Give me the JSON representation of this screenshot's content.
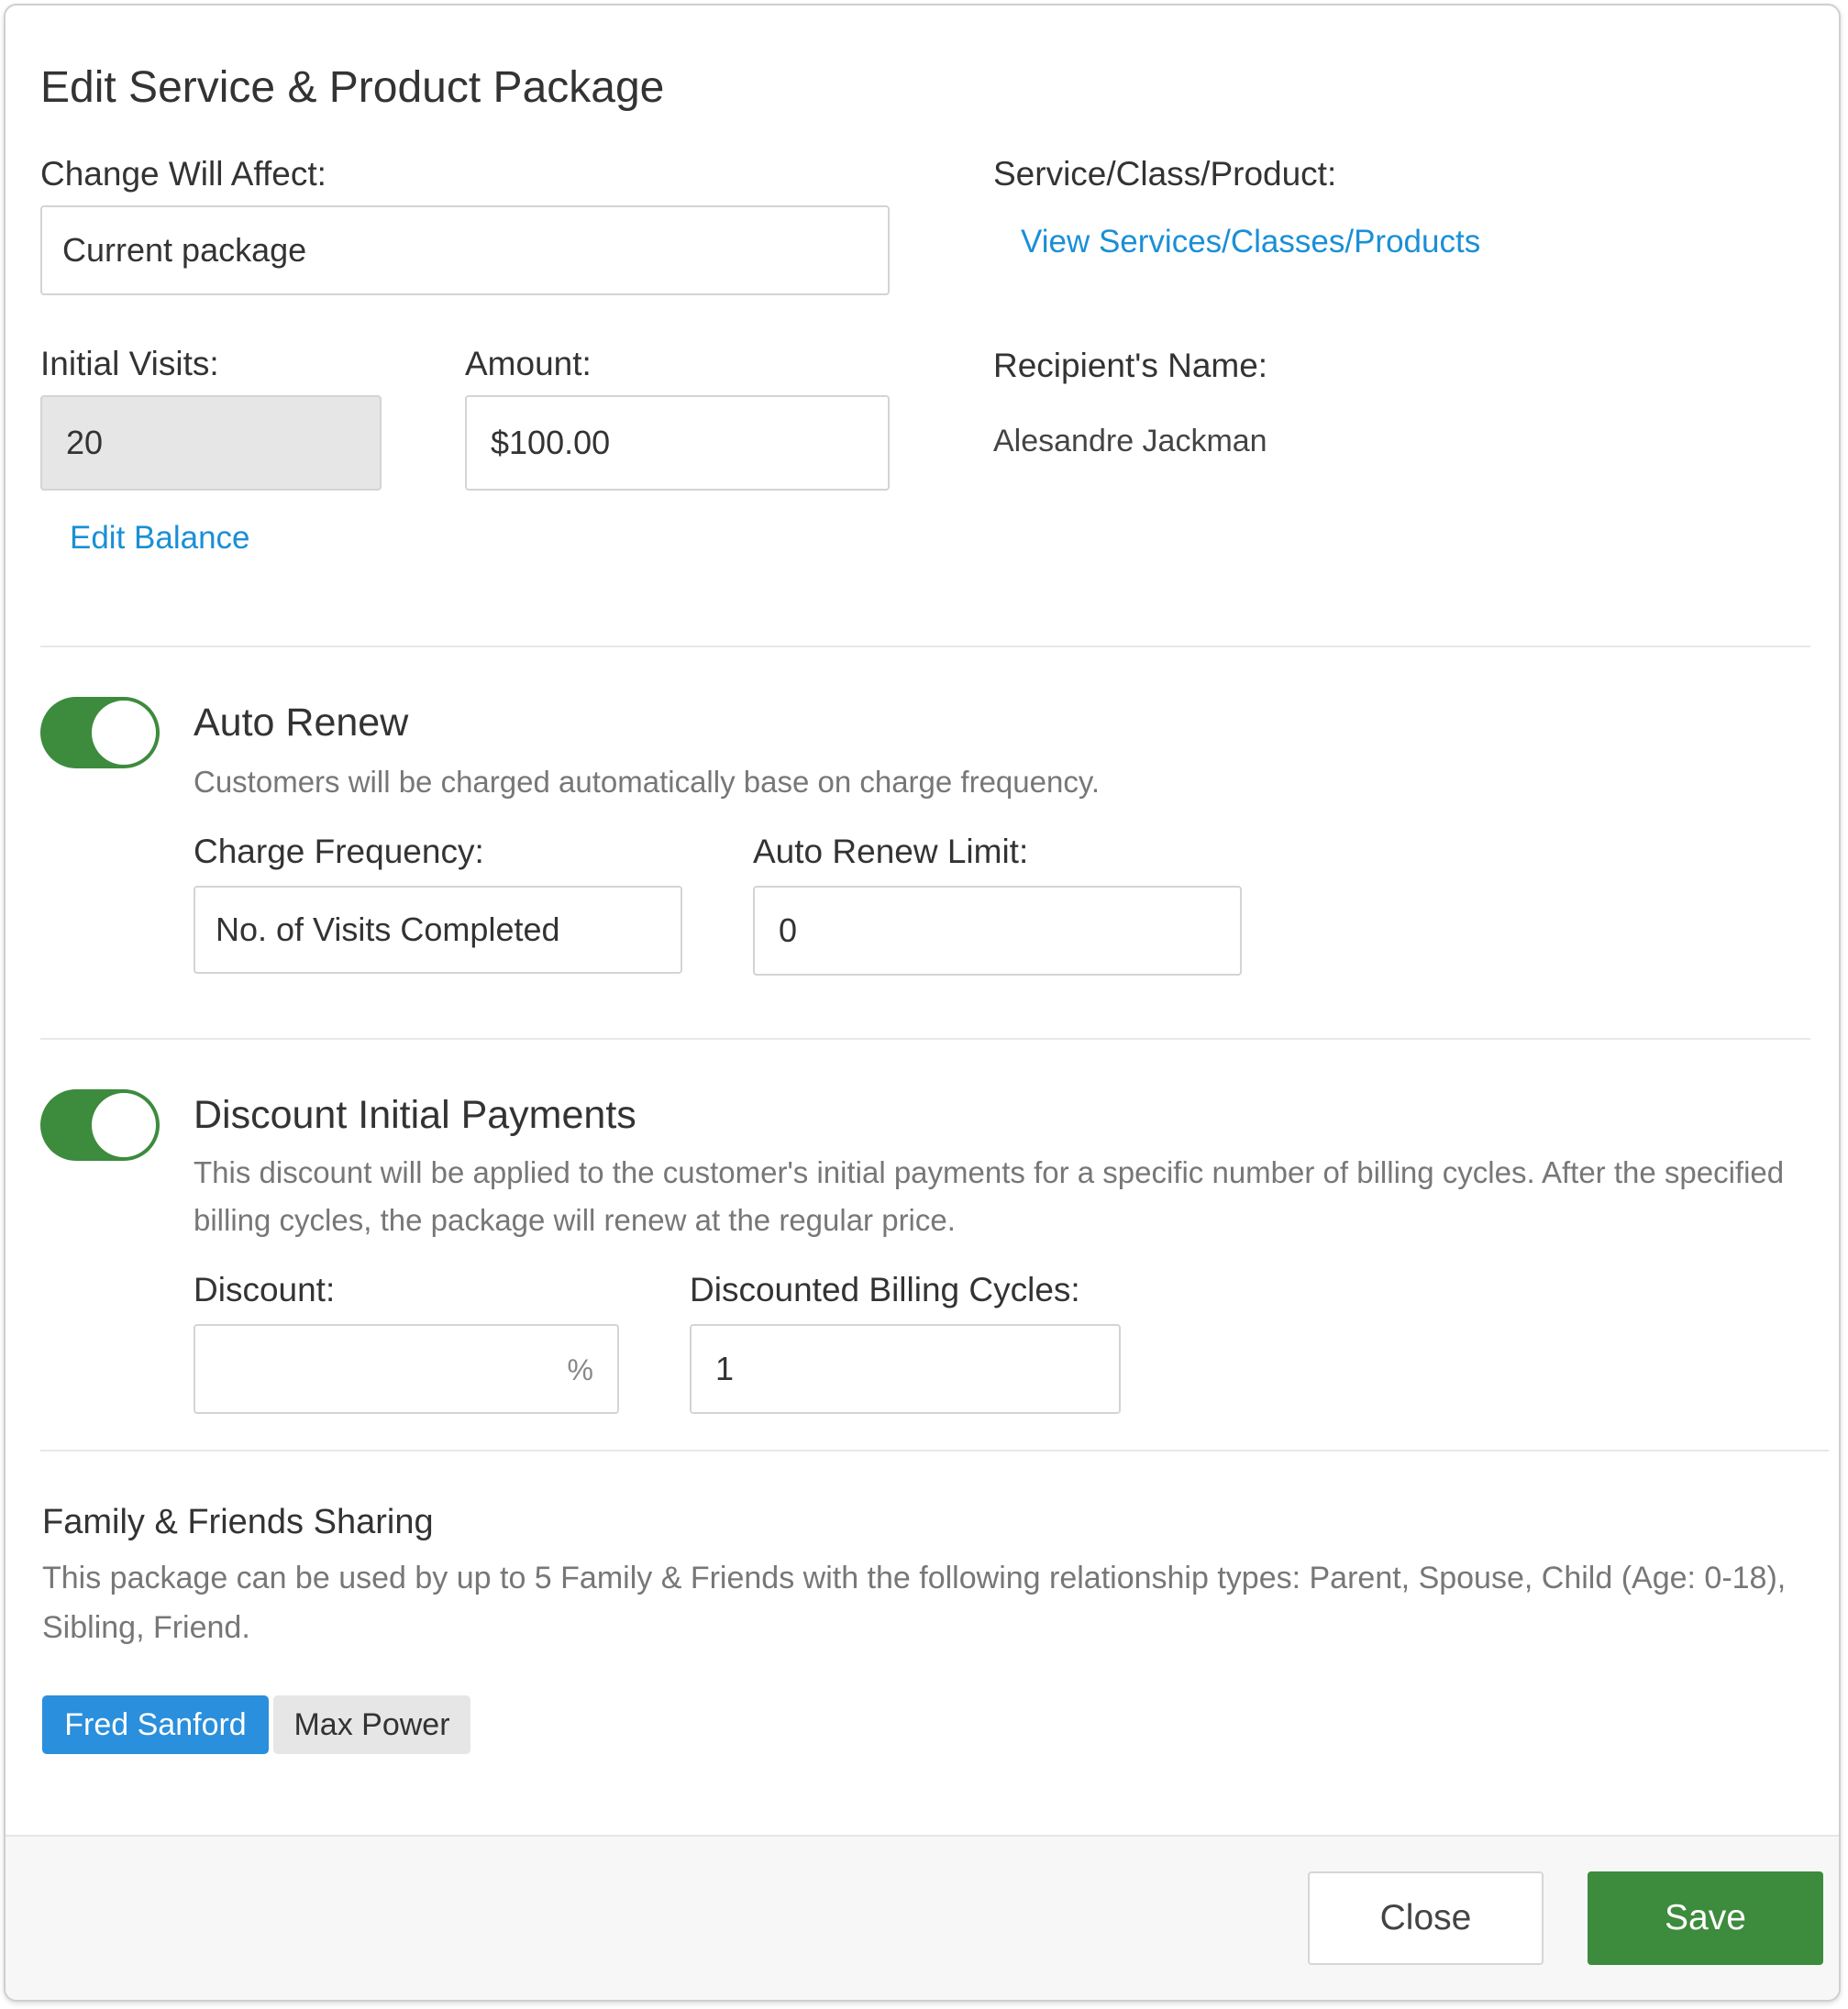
{
  "modal": {
    "title": "Edit Service & Product Package"
  },
  "change_will_affect": {
    "label": "Change Will Affect:",
    "value": "Current package"
  },
  "service_class_product": {
    "label": "Service/Class/Product:",
    "link": "View Services/Classes/Products"
  },
  "initial_visits": {
    "label": "Initial Visits:",
    "value": "20",
    "edit_link": "Edit Balance"
  },
  "amount": {
    "label": "Amount:",
    "value": "$100.00"
  },
  "recipient": {
    "label": "Recipient's Name:",
    "value": "Alesandre Jackman"
  },
  "auto_renew": {
    "title": "Auto Renew",
    "enabled": true,
    "description": "Customers will be charged automatically base on charge frequency.",
    "charge_frequency": {
      "label": "Charge Frequency:",
      "value": "No. of Visits Completed"
    },
    "limit": {
      "label": "Auto Renew Limit:",
      "value": "0"
    }
  },
  "discount_initial": {
    "title": "Discount Initial Payments",
    "enabled": true,
    "description": "This discount will be applied to the customer's initial payments for a specific number of billing cycles. After the specified billing cycles, the package will renew at the regular price.",
    "discount": {
      "label": "Discount:",
      "value": "",
      "suffix": "%"
    },
    "billing_cycles": {
      "label": "Discounted Billing Cycles:",
      "value": "1"
    }
  },
  "family_sharing": {
    "title": "Family & Friends Sharing",
    "description": "This package can be used by up to 5 Family & Friends with the following relationship types: Parent, Spouse, Child (Age: 0-18), Sibling, Friend.",
    "members": [
      "Fred Sanford",
      "Max Power"
    ]
  },
  "footer": {
    "close_label": "Close",
    "save_label": "Save"
  },
  "colors": {
    "accent_green": "#3d8b3d",
    "link_blue": "#1a8fd6",
    "tag_blue": "#2a8fdc"
  }
}
